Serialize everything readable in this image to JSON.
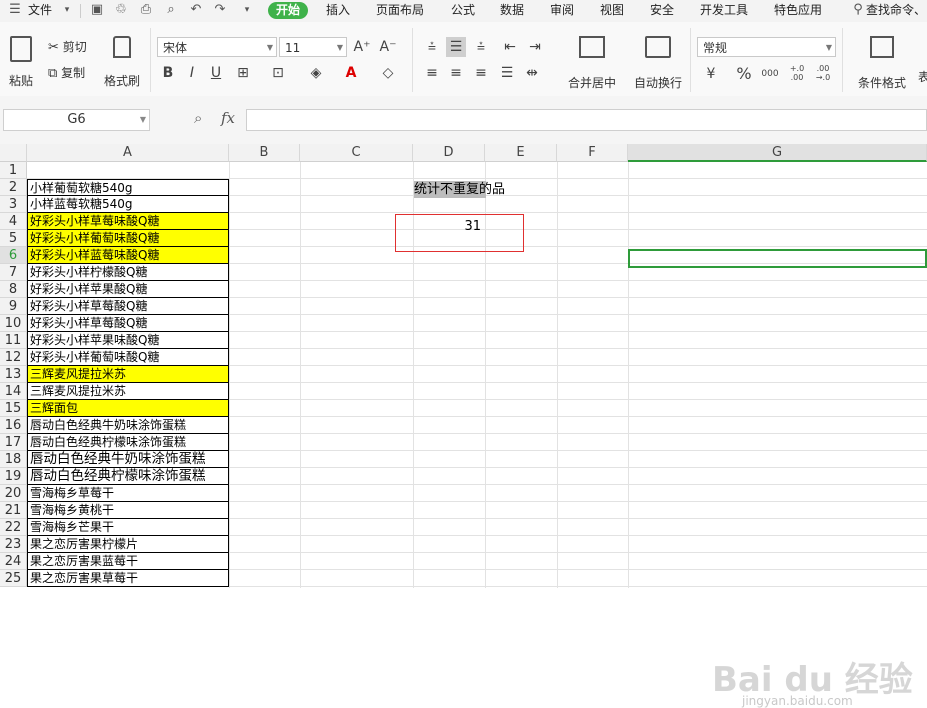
{
  "menu": {
    "file_label": "文件",
    "tabs": [
      "开始",
      "插入",
      "页面布局",
      "公式",
      "数据",
      "审阅",
      "视图",
      "安全",
      "开发工具",
      "特色应用"
    ],
    "active_tab": "开始",
    "search_label": "查找命令、"
  },
  "ribbon": {
    "paste": "粘贴",
    "cut": "剪切",
    "copy": "复制",
    "format_painter": "格式刷",
    "font_name": "宋体",
    "font_size": "11",
    "merge_center": "合并居中",
    "wrap_text": "自动换行",
    "number_format": "常规",
    "conditional_format": "条件格式",
    "overflow_label": "表",
    "percent": "%",
    "thousands": "000",
    "inc_decimal": "+.0\n.00",
    "dec_decimal": ".00\n→.0",
    "currency": "¥"
  },
  "formula_bar": {
    "name_box": "G6",
    "fx_label": "fx",
    "formula": ""
  },
  "sheet": {
    "columns": [
      "A",
      "B",
      "C",
      "D",
      "E",
      "F",
      "G"
    ],
    "active_column": "G",
    "rows": [
      {
        "n": "1",
        "a": ""
      },
      {
        "n": "2",
        "a": "小样葡萄软糖540g"
      },
      {
        "n": "3",
        "a": "小样蓝莓软糖540g"
      },
      {
        "n": "4",
        "a": "好彩头小样草莓味酸Q糖"
      },
      {
        "n": "5",
        "a": "好彩头小样葡萄味酸Q糖"
      },
      {
        "n": "6",
        "a": "好彩头小样蓝莓味酸Q糖"
      },
      {
        "n": "7",
        "a": "好彩头小样柠檬酸Q糖"
      },
      {
        "n": "8",
        "a": "好彩头小样苹果酸Q糖"
      },
      {
        "n": "9",
        "a": "好彩头小样草莓酸Q糖"
      },
      {
        "n": "10",
        "a": "好彩头小样草莓酸Q糖"
      },
      {
        "n": "11",
        "a": "好彩头小样苹果味酸Q糖"
      },
      {
        "n": "12",
        "a": "好彩头小样葡萄味酸Q糖"
      },
      {
        "n": "13",
        "a": "三辉麦风提拉米苏"
      },
      {
        "n": "14",
        "a": "三辉麦风提拉米苏"
      },
      {
        "n": "15",
        "a": "三辉面包"
      },
      {
        "n": "16",
        "a": "唇动白色经典牛奶味涂饰蛋糕"
      },
      {
        "n": "17",
        "a": "唇动白色经典柠檬味涂饰蛋糕"
      },
      {
        "n": "18",
        "a": "唇动白色经典牛奶味涂饰蛋糕"
      },
      {
        "n": "19",
        "a": "唇动白色经典柠檬味涂饰蛋糕"
      },
      {
        "n": "20",
        "a": "雪海梅乡草莓干"
      },
      {
        "n": "21",
        "a": "雪海梅乡黄桃干"
      },
      {
        "n": "22",
        "a": "雪海梅乡芒果干"
      },
      {
        "n": "23",
        "a": "果之恋厉害果柠檬片"
      },
      {
        "n": "24",
        "a": "果之恋厉害果蓝莓干"
      },
      {
        "n": "25",
        "a": "果之恋厉害果草莓干"
      }
    ],
    "d2_label": "统计不重复的品",
    "d4_value": "31"
  },
  "watermark": {
    "brand": "Bai du 经验",
    "url": "jingyan.baidu.com"
  },
  "colors": {
    "active_tab_bg": "#3fb24a",
    "highlight_yellow": "#ffff00",
    "selection_green": "#2e9b3a",
    "red_border": "#e03030"
  }
}
